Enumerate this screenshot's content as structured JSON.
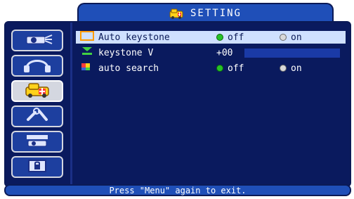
{
  "header": {
    "title": "SETTING",
    "icon": "setting-icon"
  },
  "sidebar": {
    "items": [
      {
        "name": "projector-icon"
      },
      {
        "name": "audio-icon"
      },
      {
        "name": "setting-icon",
        "active": true
      },
      {
        "name": "tools-icon"
      },
      {
        "name": "screen-icon"
      },
      {
        "name": "lock-icon"
      }
    ]
  },
  "menu": {
    "rows": [
      {
        "label": "Auto keystone",
        "icon": "auto-keystone-icon",
        "option1": "off",
        "option2": "on",
        "selected": true
      },
      {
        "label": "keystone V",
        "icon": "keystone-v-icon",
        "value": "+00",
        "level": 0.0
      },
      {
        "label": "auto search",
        "icon": "auto-search-icon",
        "option1": "off",
        "option2": "on"
      }
    ]
  },
  "footer": {
    "hint": "Press \"Menu\" again to exit."
  },
  "colors": {
    "panel": "#0a1a5e",
    "tab": "#1f4fb8",
    "selected_row": "#cfe0ff",
    "radio_on": "#27c227",
    "radio_off": "#d9d9d9"
  }
}
